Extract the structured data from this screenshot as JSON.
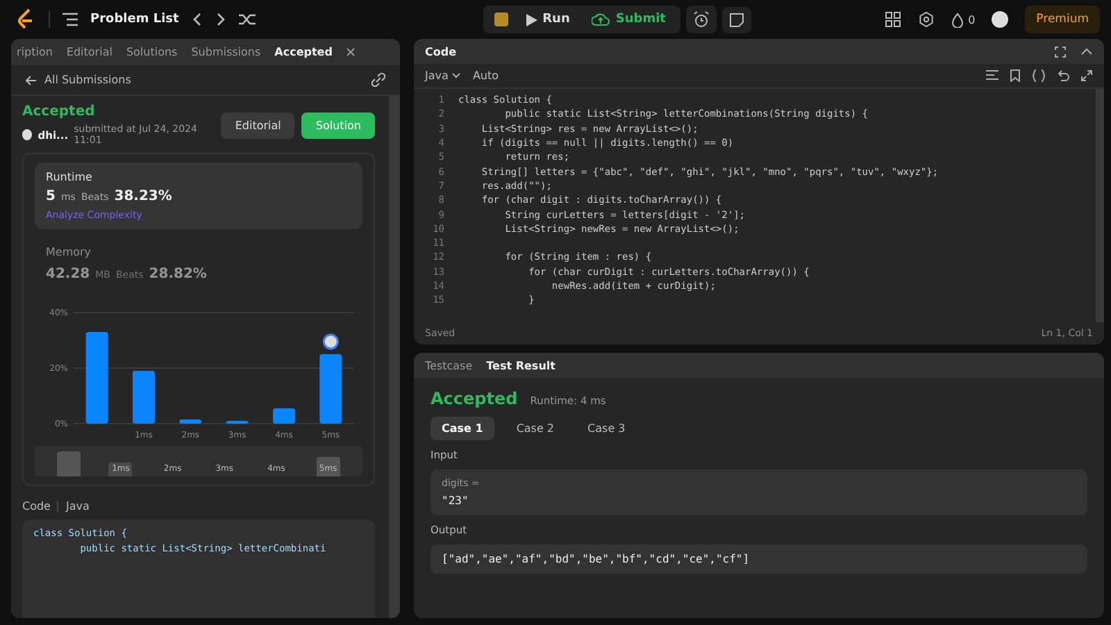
{
  "topbar": {
    "title": "Problem List",
    "run": "Run",
    "submit": "Submit",
    "streak": "0",
    "premium": "Premium"
  },
  "left_tabs": [
    {
      "label": "ription",
      "selected": false
    },
    {
      "label": "Editorial",
      "selected": false
    },
    {
      "label": "Solutions",
      "selected": false
    },
    {
      "label": "Submissions",
      "selected": false
    },
    {
      "label": "Accepted",
      "selected": true
    }
  ],
  "back_link": "All Submissions",
  "submission": {
    "status": "Accepted",
    "user": "dhi...",
    "submitted": "submitted at Jul 24, 2024 11:01",
    "editorial_button": "Editorial",
    "solution_button": "Solution"
  },
  "runtime": {
    "title": "Runtime",
    "value": "5",
    "unit": "ms",
    "beats_label": "Beats",
    "beats": "38.23%",
    "analyze": "Analyze Complexity"
  },
  "memory": {
    "title": "Memory",
    "value": "42.28",
    "unit": "MB",
    "beats_label": "Beats",
    "beats": "28.82%"
  },
  "chart_data": {
    "type": "bar",
    "x": [
      0,
      1,
      2,
      3,
      4,
      5
    ],
    "xlim": [
      -0.5,
      5.5
    ],
    "values": [
      33,
      19,
      1.5,
      1,
      5.5,
      25
    ],
    "ylim": [
      0,
      40
    ],
    "yticks": [
      {
        "value": 0,
        "label": "0%"
      },
      {
        "value": 20,
        "label": "20%"
      },
      {
        "value": 40,
        "label": "40%"
      }
    ],
    "xticks": [
      {
        "value": 1,
        "label": "1ms"
      },
      {
        "value": 2,
        "label": "2ms"
      },
      {
        "value": 3,
        "label": "3ms"
      },
      {
        "value": 4,
        "label": "4ms"
      },
      {
        "value": 5,
        "label": "5ms"
      }
    ]
  },
  "overview_labels": [
    "1ms",
    "2ms",
    "3ms",
    "4ms",
    "5ms"
  ],
  "code_section": {
    "title": "Code",
    "language": "Java",
    "lines": [
      "class Solution {",
      "        public static List<String> letterCombinati"
    ]
  },
  "editor": {
    "title": "Code",
    "language": "Java",
    "mode": "Auto",
    "status": "Saved",
    "cursor": "Ln 1, Col 1",
    "lines": [
      {
        "no": "1",
        "text": "class Solution {"
      },
      {
        "no": "2",
        "text": "        public static List<String> letterCombinations(String digits) {"
      },
      {
        "no": "3",
        "text": "    List<String> res = new ArrayList<>();"
      },
      {
        "no": "4",
        "text": "    if (digits == null || digits.length() == 0)"
      },
      {
        "no": "5",
        "text": "        return res;"
      },
      {
        "no": "6",
        "text": "    String[] letters = {\"abc\", \"def\", \"ghi\", \"jkl\", \"mno\", \"pqrs\", \"tuv\", \"wxyz\"};"
      },
      {
        "no": "7",
        "text": "    res.add(\"\");"
      },
      {
        "no": "8",
        "text": "    for (char digit : digits.toCharArray()) {"
      },
      {
        "no": "9",
        "text": "        String curLetters = letters[digit - '2'];"
      },
      {
        "no": "10",
        "text": "        List<String> newRes = new ArrayList<>();"
      },
      {
        "no": "11"
      },
      {
        "no": "12",
        "text": "        for (String item : res) {"
      },
      {
        "no": "13",
        "text": "            for (char curDigit : curLetters.toCharArray()) {"
      },
      {
        "no": "14",
        "text": "                newRes.add(item + curDigit);"
      },
      {
        "no": "15",
        "text": "            }"
      }
    ]
  },
  "bottom_tabs": [
    {
      "label": "Testcase",
      "selected": false
    },
    {
      "label": "Test Result",
      "selected": true
    }
  ],
  "result": {
    "status": "Accepted",
    "runtime": "Runtime: 4 ms",
    "cases": [
      {
        "label": "Case 1",
        "selected": true
      },
      {
        "label": "Case 2",
        "selected": false
      },
      {
        "label": "Case 3",
        "selected": false
      }
    ],
    "input_label": "Input",
    "param": "digits =",
    "param_value": "\"23\"",
    "output_label": "Output",
    "output": "[\"ad\",\"ae\",\"af\",\"bd\",\"be\",\"bf\",\"cd\",\"ce\",\"cf\"]"
  }
}
